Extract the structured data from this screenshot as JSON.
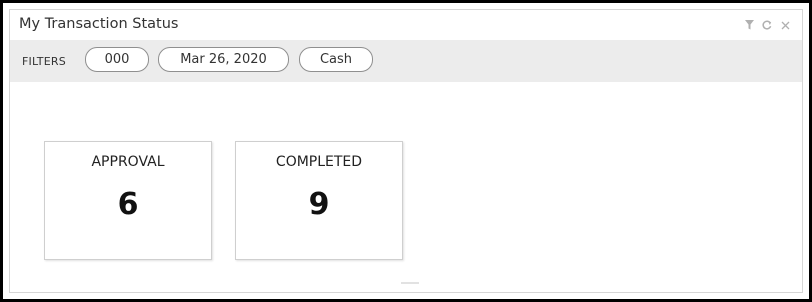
{
  "widget": {
    "title": "My Transaction Status",
    "icons": {
      "filter": "filter-icon",
      "refresh": "refresh-icon",
      "close": "close-icon"
    }
  },
  "filters": {
    "label": "FILTERS",
    "chips": [
      "000",
      "Mar 26, 2020",
      "Cash"
    ]
  },
  "cards": [
    {
      "label": "APPROVAL",
      "value": "6"
    },
    {
      "label": "COMPLETED",
      "value": "9"
    }
  ],
  "colors": {
    "filter_bar_bg": "#ececec",
    "chip_border": "#8f8f8f",
    "icon_gray": "#b0b0b0"
  }
}
